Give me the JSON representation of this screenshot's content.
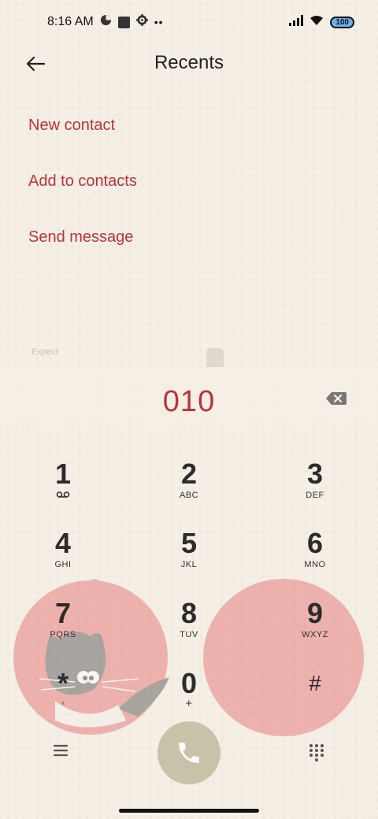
{
  "status_bar": {
    "time": "8:16 AM",
    "battery": "100",
    "icons": [
      "data-saver-icon",
      "square-notification-icon",
      "settings-gear-icon",
      "more-dots-icon",
      "signal-icon",
      "wifi-icon",
      "battery-icon"
    ]
  },
  "header": {
    "title": "Recents",
    "back_icon": "arrow-left-icon"
  },
  "menu": {
    "items": [
      {
        "label": "New contact"
      },
      {
        "label": "Add to contacts"
      },
      {
        "label": "Send message"
      }
    ]
  },
  "background_text": "Expect",
  "dialer": {
    "number": "010",
    "backspace_icon": "backspace-icon",
    "keys": [
      {
        "digit": "1",
        "letters": "",
        "icon": "voicemail-icon"
      },
      {
        "digit": "2",
        "letters": "ABC"
      },
      {
        "digit": "3",
        "letters": "DEF"
      },
      {
        "digit": "4",
        "letters": "GHI"
      },
      {
        "digit": "5",
        "letters": "JKL"
      },
      {
        "digit": "6",
        "letters": "MNO"
      },
      {
        "digit": "7",
        "letters": "PQRS"
      },
      {
        "digit": "8",
        "letters": "TUV"
      },
      {
        "digit": "9",
        "letters": "WXYZ"
      },
      {
        "digit": "*",
        "letters": ","
      },
      {
        "digit": "0",
        "letters": "+"
      },
      {
        "digit": "#",
        "letters": ""
      }
    ]
  },
  "bottom_bar": {
    "menu_icon": "hamburger-menu-icon",
    "call_icon": "phone-icon",
    "dialpad_icon": "dialpad-grid-icon"
  },
  "colors": {
    "background": "#f5efe6",
    "accent": "#b5353c",
    "call_button": "#c7c3a9",
    "apple": "#e07a72"
  }
}
